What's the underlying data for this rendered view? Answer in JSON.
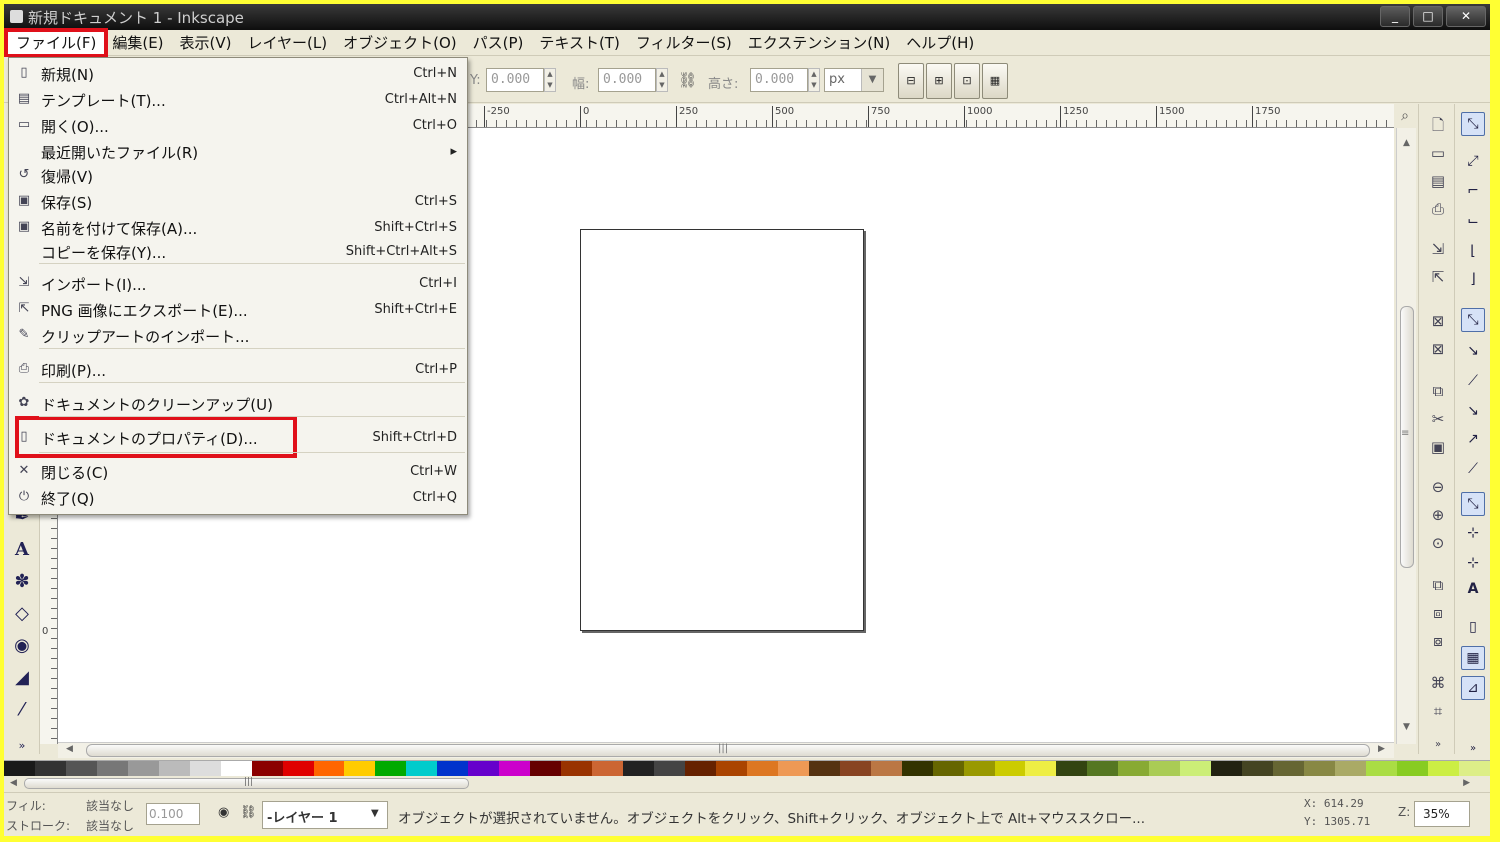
{
  "window": {
    "title": "新規ドキュメント 1 - Inkscape",
    "controls": [
      "_",
      "□",
      "✕"
    ]
  },
  "menubar": [
    "ファイル(F)",
    "編集(E)",
    "表示(V)",
    "レイヤー(L)",
    "オブジェクト(O)",
    "パス(P)",
    "テキスト(T)",
    "フィルター(S)",
    "エクステンション(N)",
    "ヘルプ(H)"
  ],
  "toolbar": {
    "y_label": "Y:",
    "y_value": "0.000",
    "w_label": "幅:",
    "w_value": "0.000",
    "h_label": "高さ:",
    "h_value": "0.000",
    "unit": "px",
    "btn_icons": [
      "scale-stroke-icon",
      "scale-corners-icon",
      "move-gradients-icon",
      "move-patterns-icon"
    ]
  },
  "ruler": {
    "h_labels": [
      "-250",
      "0",
      "250",
      "500",
      "750",
      "1000",
      "1250",
      "1500",
      "1750"
    ],
    "v_label": "0"
  },
  "file_menu": {
    "items": [
      {
        "icon": "new-document-icon",
        "label": "新規(N)",
        "shortcut": "Ctrl+N"
      },
      {
        "icon": "template-icon",
        "label": "テンプレート(T)...",
        "shortcut": "Ctrl+Alt+N"
      },
      {
        "icon": "open-folder-icon",
        "label": "開く(O)...",
        "shortcut": "Ctrl+O"
      },
      {
        "icon": "",
        "label": "最近開いたファイル(R)",
        "shortcut": "▸"
      },
      {
        "icon": "revert-icon",
        "label": "復帰(V)",
        "shortcut": ""
      },
      {
        "icon": "save-icon",
        "label": "保存(S)",
        "shortcut": "Ctrl+S"
      },
      {
        "icon": "save-as-icon",
        "label": "名前を付けて保存(A)...",
        "shortcut": "Shift+Ctrl+S"
      },
      {
        "icon": "",
        "label": "コピーを保存(Y)...",
        "shortcut": "Shift+Ctrl+Alt+S"
      },
      {
        "icon": "import-icon",
        "label": "インポート(I)...",
        "shortcut": "Ctrl+I"
      },
      {
        "icon": "export-png-icon",
        "label": "PNG 画像にエクスポート(E)...",
        "shortcut": "Shift+Ctrl+E"
      },
      {
        "icon": "clipart-icon",
        "label": "クリップアートのインポート...",
        "shortcut": ""
      },
      {
        "icon": "print-icon",
        "label": "印刷(P)...",
        "shortcut": "Ctrl+P"
      },
      {
        "icon": "cleanup-icon",
        "label": "ドキュメントのクリーンアップ(U)",
        "shortcut": ""
      },
      {
        "icon": "document-properties-icon",
        "label": "ドキュメントのプロパティ(D)...",
        "shortcut": "Shift+Ctrl+D"
      },
      {
        "icon": "close-icon",
        "label": "閉じる(C)",
        "shortcut": "Ctrl+W"
      },
      {
        "icon": "quit-icon",
        "label": "終了(Q)",
        "shortcut": "Ctrl+Q"
      }
    ]
  },
  "statusbar": {
    "fill_label": "フィル:",
    "fill_value": "該当なし",
    "stroke_label": "ストローク:",
    "stroke_value": "該当なし",
    "opacity": "0.100",
    "layer": "-レイヤー 1",
    "message": "オブジェクトが選択されていません。オブジェクトをクリック、Shift+クリック、オブジェクト上で Alt+マウススクロー...",
    "x_coord": "X: 614.29",
    "y_coord": "Y: 1305.71",
    "zoom_label": "Z:",
    "zoom_value": "35%"
  },
  "palette": [
    "#1a1a1a",
    "#333333",
    "#555555",
    "#777777",
    "#999999",
    "#bbbbbb",
    "#dddddd",
    "#ffffff",
    "#8b0000",
    "#e00000",
    "#ff6600",
    "#ffcc00",
    "#00aa00",
    "#00cccc",
    "#0033cc",
    "#6600cc",
    "#cc00cc",
    "#660000",
    "#993300",
    "#cc6633",
    "#222222",
    "#444444",
    "#662200",
    "#aa4400",
    "#dd7722",
    "#ee9955",
    "#553311",
    "#884422",
    "#bb7744",
    "#333300",
    "#666600",
    "#999900",
    "#cccc00",
    "#eeee44",
    "#334411",
    "#557722",
    "#88aa33",
    "#aacc55",
    "#ccee77",
    "#222211",
    "#444422",
    "#666633",
    "#888844",
    "#aaaa66",
    "#aadd44",
    "#88cc22",
    "#ccee44",
    "#ddee88"
  ],
  "highlight_color": "#e0101a"
}
